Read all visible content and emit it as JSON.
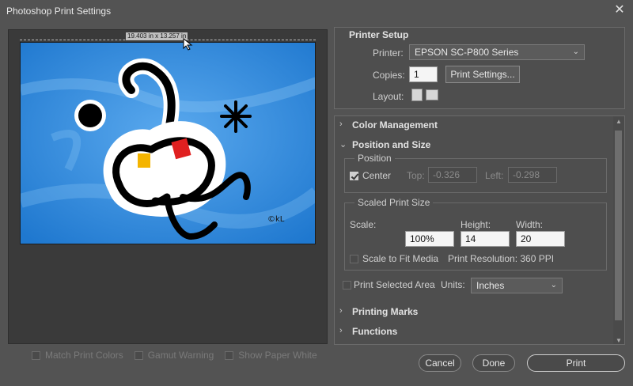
{
  "window": {
    "title": "Photoshop Print Settings"
  },
  "preview": {
    "dimension_label": "19.403 in x 13.257 in",
    "options": [
      {
        "label": "Match Print Colors"
      },
      {
        "label": "Gamut Warning"
      },
      {
        "label": "Show Paper White"
      }
    ]
  },
  "printer_setup": {
    "heading": "Printer Setup",
    "printer_label": "Printer:",
    "printer_value": "EPSON SC-P800 Series",
    "copies_label": "Copies:",
    "copies_value": "1",
    "print_settings_button": "Print Settings...",
    "layout_label": "Layout:"
  },
  "sections": {
    "color_management": "Color Management",
    "position_and_size": "Position and Size",
    "printing_marks": "Printing Marks",
    "functions": "Functions"
  },
  "position": {
    "group_title": "Position",
    "center_label": "Center",
    "center_checked": true,
    "top_label": "Top:",
    "top_value": "-0.326",
    "left_label": "Left:",
    "left_value": "-0.298"
  },
  "scaled_print_size": {
    "group_title": "Scaled Print Size",
    "scale_label": "Scale:",
    "scale_value": "100%",
    "height_label": "Height:",
    "height_value": "14",
    "width_label": "Width:",
    "width_value": "20",
    "scale_to_fit_label": "Scale to Fit Media",
    "print_resolution": "Print Resolution: 360 PPI"
  },
  "print_selected_area": {
    "label": "Print Selected Area",
    "units_label": "Units:",
    "units_value": "Inches"
  },
  "footer": {
    "cancel": "Cancel",
    "done": "Done",
    "print": "Print"
  },
  "artwork": {
    "signature": "©kL"
  }
}
